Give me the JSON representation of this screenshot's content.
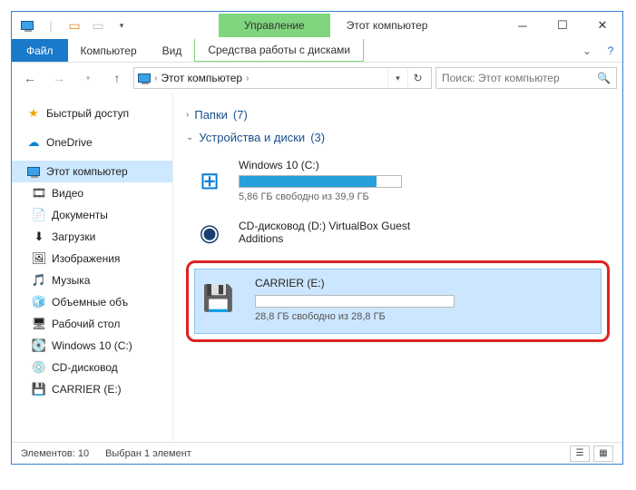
{
  "title": "Этот компьютер",
  "ribbon": {
    "context_tab": "Управление",
    "file": "Файл",
    "tabs": [
      "Компьютер",
      "Вид"
    ],
    "context_sub": "Средства работы с дисками"
  },
  "nav": {
    "breadcrumb": "Этот компьютер",
    "search_placeholder": "Поиск: Этот компьютер"
  },
  "tree": {
    "quick_access": "Быстрый доступ",
    "onedrive": "OneDrive",
    "this_pc": "Этот компьютер",
    "items": [
      {
        "icon": "🎞",
        "label": "Видео"
      },
      {
        "icon": "📄",
        "label": "Документы"
      },
      {
        "icon": "⬇",
        "label": "Загрузки"
      },
      {
        "icon": "🖼",
        "label": "Изображения"
      },
      {
        "icon": "🎵",
        "label": "Музыка"
      },
      {
        "icon": "🧊",
        "label": "Объемные объ"
      },
      {
        "icon": "🖥",
        "label": "Рабочий стол"
      },
      {
        "icon": "💽",
        "label": "Windows 10 (C:)"
      },
      {
        "icon": "💿",
        "label": "CD-дисковод"
      },
      {
        "icon": "💾",
        "label": "CARRIER (E:)"
      }
    ]
  },
  "groups": {
    "folders": {
      "label": "Папки",
      "count": "(7)"
    },
    "devices": {
      "label": "Устройства и диски",
      "count": "(3)"
    }
  },
  "drives": {
    "c": {
      "name": "Windows 10 (C:)",
      "free": "5,86 ГБ свободно из 39,9 ГБ",
      "fill_pct": 85
    },
    "d": {
      "name": "CD-дисковод (D:) VirtualBox Guest Additions",
      "free": ""
    },
    "e": {
      "name": "CARRIER (E:)",
      "free": "28,8 ГБ свободно из 28,8 ГБ",
      "fill_pct": 0
    }
  },
  "status": {
    "items": "Элементов: 10",
    "selected": "Выбран 1 элемент"
  }
}
